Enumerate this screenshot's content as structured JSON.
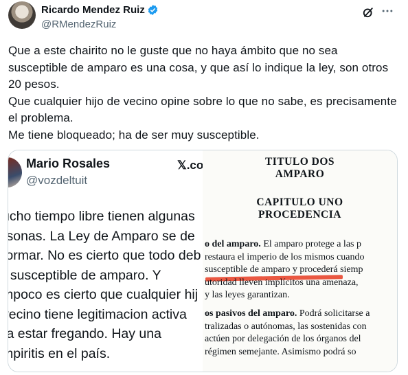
{
  "author": {
    "display_name": "Ricardo Mendez Ruiz",
    "handle": "@RMendezRuiz"
  },
  "icons": {
    "verified": "verified-badge-icon",
    "grok": "grok-icon",
    "more": "more-icon"
  },
  "colors": {
    "verified": "#1d9bf0",
    "secondary_text": "#536471",
    "highlight_mark": "#e8462e"
  },
  "tweet": {
    "paragraphs": [
      "Que a este chairito no le guste que no haya ámbito que no sea susceptible de amparo es una cosa, y que así lo indique la ley, son otros 20 pesos.",
      "Que cualquier hijo de vecino opine sobre lo que no sabe, es precisamente el problema.",
      "Me tiene bloqueado; ha de ser muy susceptible."
    ]
  },
  "quoted": {
    "name": "Mario Rosales",
    "handle": "@vozdeltuit",
    "source": "𝕏.co",
    "lines": [
      "ucho tiempo libre tienen algunas",
      "rsonas.  La Ley de Amparo se de",
      "formar. No es cierto que todo deb",
      "r susceptible de amparo. Y",
      "mpoco es cierto que cualquier hij",
      " vecino tiene legitimacion activa",
      "ra estar fregando. Hay una",
      "mpiritis en el país."
    ]
  },
  "document": {
    "title_1": "TITULO DOS",
    "title_2": "AMPARO",
    "chapter_1": "CAPITULO UNO",
    "chapter_2": "PROCEDENCIA",
    "p1_bold": "o del amparo.",
    "p1_lines": [
      "  El amparo protege a las p",
      "restaura el imperio de los mismos cuando",
      "susceptible de amparo y procederá siemp",
      "utoridad lleven implícitos una amenaza,",
      "y las leyes garantizan."
    ],
    "p2_bold": "os pasivos del amparo.",
    "p2_lines": [
      "  Podrá solicitarse a",
      "tralizadas o autónomas, las sostenidas con",
      "actúen por delegación de los órganos del",
      "régimen semejante.  Asimismo podrá so"
    ]
  }
}
